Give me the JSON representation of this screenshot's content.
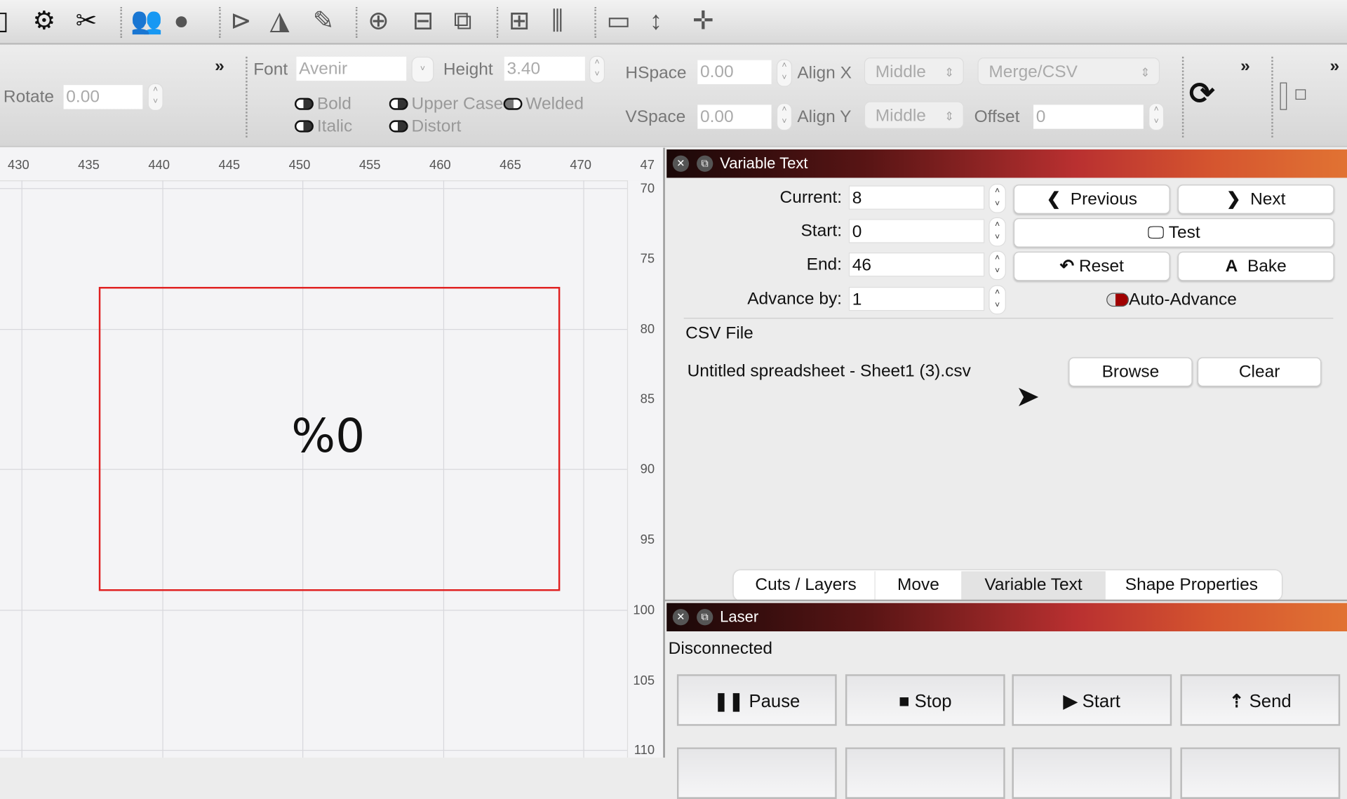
{
  "toolbar": {
    "icons": [
      "device-icon",
      "settings-icon",
      "tools-icon",
      "users-icon",
      "user-icon",
      "flip-vertical-icon",
      "mirror-icon",
      "pen-icon",
      "target-icon",
      "align-center-icon",
      "distribute-icon",
      "align-middle-icon",
      "align-vertical-icon",
      "resize-icon",
      "dimension-icon",
      "crosshair-icon"
    ]
  },
  "text_options": {
    "rotate_label": "Rotate",
    "rotate_value": "0.00",
    "font_label": "Font",
    "font_value": "Avenir",
    "height_label": "Height",
    "height_value": "3.40",
    "hspace_label": "HSpace",
    "hspace_value": "0.00",
    "vspace_label": "VSpace",
    "vspace_value": "0.00",
    "alignx_label": "Align X",
    "alignx_value": "Middle",
    "aligny_label": "Align Y",
    "aligny_value": "Middle",
    "mode_value": "Merge/CSV",
    "offset_label": "Offset",
    "offset_value": "0",
    "bold": "Bold",
    "italic": "Italic",
    "upper_case": "Upper Case",
    "distort": "Distort",
    "welded": "Welded",
    "more": "»"
  },
  "ruler": {
    "x_labels": [
      "430",
      "435",
      "440",
      "445",
      "450",
      "455",
      "460",
      "465",
      "470",
      "47"
    ],
    "y_labels": [
      "70",
      "75",
      "80",
      "85",
      "90",
      "95",
      "100",
      "105",
      "110"
    ]
  },
  "canvas": {
    "text": "%0",
    "shape_color": "#e02020"
  },
  "variable_text": {
    "title": "Variable Text",
    "current_label": "Current:",
    "current": "8",
    "start_label": "Start:",
    "start": "0",
    "end_label": "End:",
    "end": "46",
    "advance_label": "Advance by:",
    "advance": "1",
    "previous": "Previous",
    "next": "Next",
    "test": "Test",
    "reset": "Reset",
    "bake": "Bake",
    "auto_advance": "Auto-Advance",
    "csv_label": "CSV File",
    "csv_file": "Untitled spreadsheet - Sheet1 (3).csv",
    "browse": "Browse",
    "clear": "Clear"
  },
  "tabs": [
    {
      "label": "Cuts / Layers"
    },
    {
      "label": "Move"
    },
    {
      "label": "Variable Text",
      "active": true
    },
    {
      "label": "Shape Properties"
    }
  ],
  "laser": {
    "title": "Laser",
    "status": "Disconnected",
    "pause": "Pause",
    "stop": "Stop",
    "start": "Start",
    "send": "Send"
  }
}
